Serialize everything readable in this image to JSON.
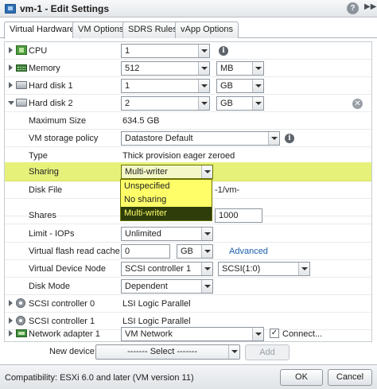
{
  "window": {
    "title": "vm-1 - Edit Settings"
  },
  "tabs": [
    {
      "label": "Virtual Hardware"
    },
    {
      "label": "VM Options"
    },
    {
      "label": "SDRS Rules"
    },
    {
      "label": "vApp Options"
    }
  ],
  "hardware": {
    "cpu": {
      "label": "CPU",
      "value": "1"
    },
    "memory": {
      "label": "Memory",
      "value": "512",
      "unit": "MB"
    },
    "hard_disk_1": {
      "label": "Hard disk 1",
      "value": "1",
      "unit": "GB"
    },
    "hard_disk_2": {
      "label": "Hard disk 2",
      "value": "2",
      "unit": "GB",
      "max_size": {
        "label": "Maximum Size",
        "value": "634.5 GB"
      },
      "storage_policy": {
        "label": "VM storage policy",
        "value": "Datastore Default"
      },
      "type": {
        "label": "Type",
        "value": "Thick provision eager zeroed"
      },
      "sharing": {
        "label": "Sharing",
        "value": "Multi-writer"
      },
      "disk_file": {
        "label": "Disk File",
        "value": "-1/vm-"
      },
      "shares": {
        "label": "Shares",
        "value": "1000"
      },
      "limit_iops": {
        "label": "Limit - IOPs",
        "value": "Unlimited"
      },
      "flash_cache": {
        "label": "Virtual flash read cache",
        "value": "0",
        "unit": "GB",
        "advanced_link": "Advanced"
      },
      "device_node": {
        "label": "Virtual Device Node",
        "controller": "SCSI controller 1",
        "node": "SCSI(1:0)"
      },
      "disk_mode": {
        "label": "Disk Mode",
        "value": "Dependent"
      }
    },
    "scsi_controller_0": {
      "label": "SCSI controller 0",
      "value": "LSI Logic Parallel"
    },
    "scsi_controller_1": {
      "label": "SCSI controller 1",
      "value": "LSI Logic Parallel"
    },
    "network_adapter_1": {
      "label": "Network adapter 1",
      "value": "VM Network",
      "connect_label": "Connect...",
      "connected": true
    }
  },
  "sharing_dropdown": {
    "options": [
      "Unspecified",
      "No sharing",
      "Multi-writer"
    ],
    "selected": "Multi-writer"
  },
  "new_device": {
    "label": "New device:",
    "select": "------- Select -------",
    "add_label": "Add"
  },
  "footer": {
    "compatibility": "Compatibility: ESXi 6.0 and later (VM version 11)",
    "ok_label": "OK",
    "cancel_label": "Cancel"
  },
  "icons": {
    "window": "vm-icon",
    "help": "help-icon",
    "expand": "expand-icon",
    "cpu": "cpu-icon",
    "memory": "memory-icon",
    "disk": "hard-disk-icon",
    "controller": "scsi-controller-icon",
    "network": "network-adapter-icon",
    "info": "info-icon",
    "remove": "remove-icon"
  },
  "colors": {
    "highlight": "#e6f17a",
    "dropdown_bg": "#fffe69",
    "dropdown_selected": "#2e3d0a",
    "link": "#1b5fae"
  }
}
